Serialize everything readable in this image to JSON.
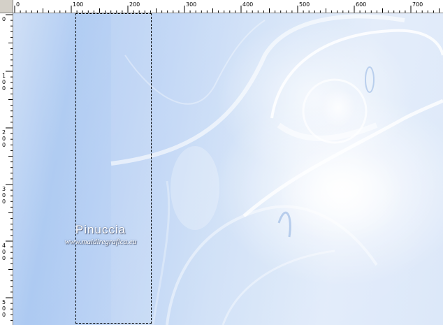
{
  "rulers": {
    "top_labels": [
      "0",
      "100",
      "200",
      "300",
      "400",
      "500",
      "600",
      "700"
    ],
    "left_labels": [
      "0",
      "100",
      "200",
      "300",
      "400",
      "500"
    ]
  },
  "watermark": {
    "name": "Pinuccia",
    "url": "www.maidiregrafica.eu"
  },
  "colors": {
    "ruler_bg": "#ffffff",
    "canvas_blue": "#a7c6f1",
    "highlight": "#ffffff"
  }
}
